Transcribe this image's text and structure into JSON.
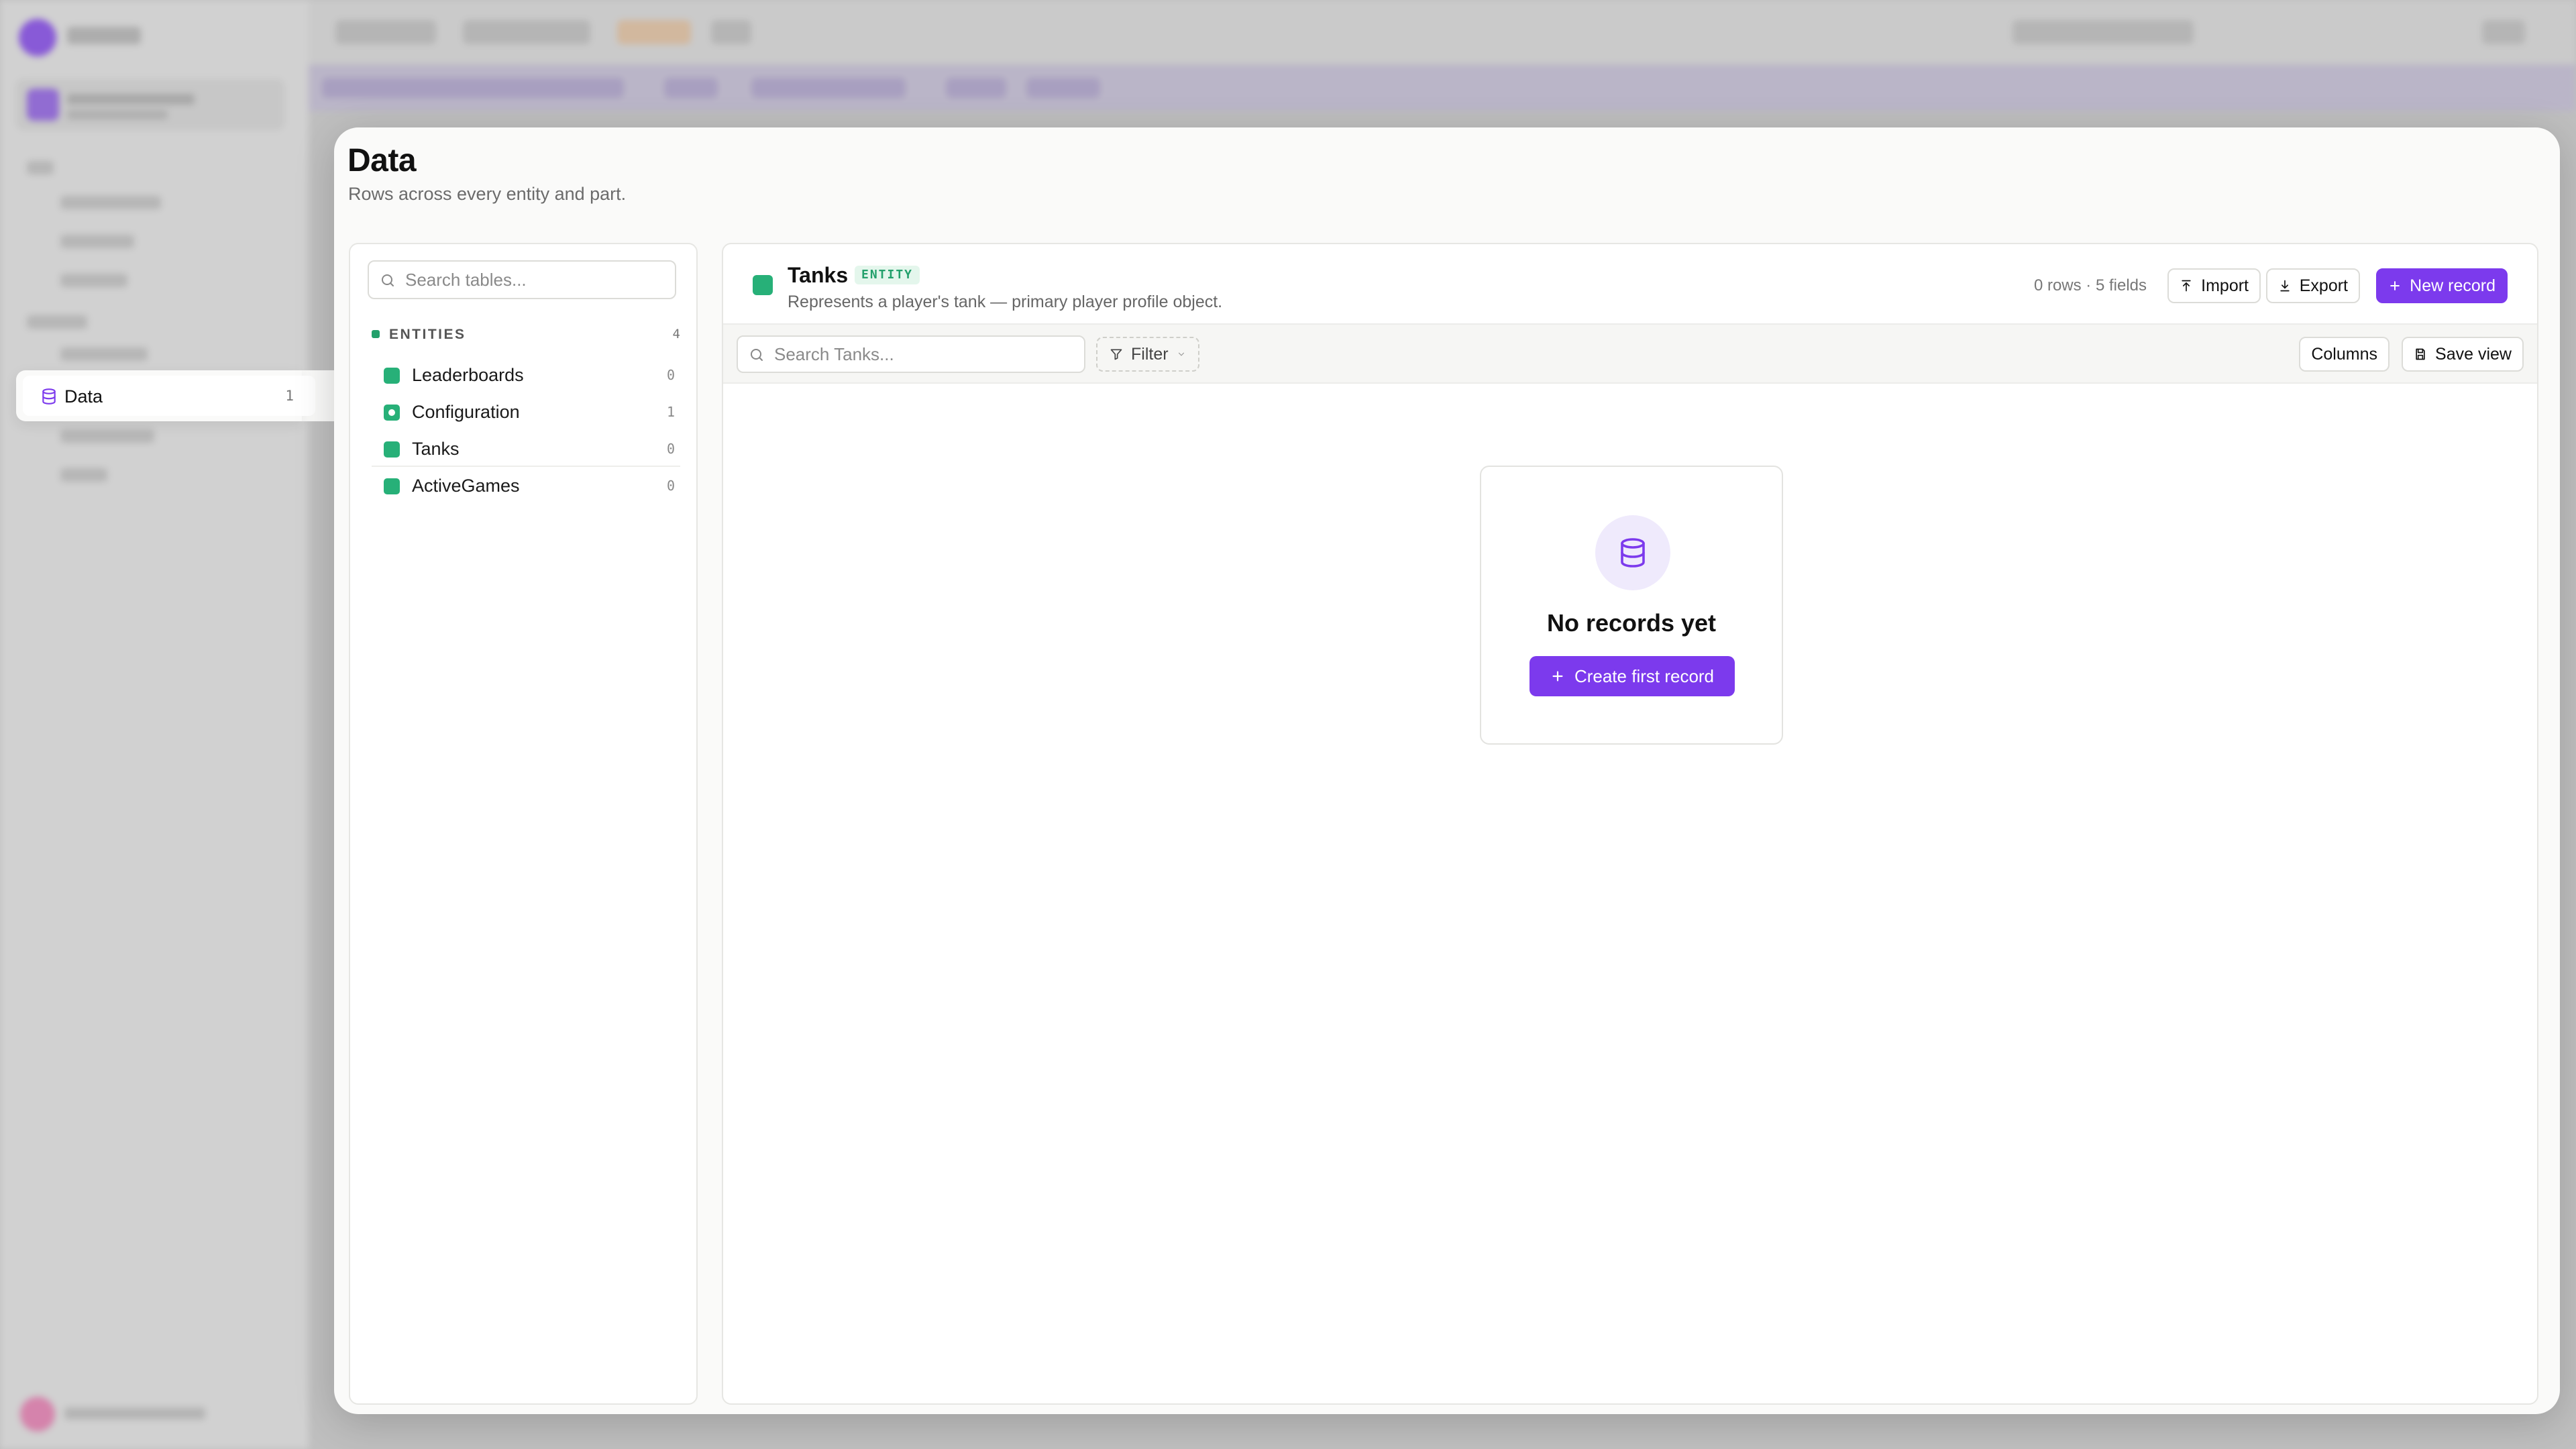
{
  "nav": {
    "active_item": {
      "label": "Data",
      "count": "1",
      "icon": "database-icon"
    }
  },
  "page": {
    "title": "Data",
    "subtitle": "Rows across every entity and part."
  },
  "tables_panel": {
    "search_placeholder": "Search tables...",
    "section_label": "ENTITIES",
    "section_count": "4",
    "items": [
      {
        "name": "Leaderboards",
        "count": "0"
      },
      {
        "name": "Configuration",
        "count": "1"
      },
      {
        "name": "Tanks",
        "count": "0"
      },
      {
        "name": "ActiveGames",
        "count": "0"
      }
    ]
  },
  "table": {
    "name": "Tanks",
    "badge": "ENTITY",
    "description": "Represents a player's tank — primary player profile object.",
    "meta": "0 rows · 5 fields",
    "import_label": "Import",
    "export_label": "Export",
    "new_record_label": "New record",
    "search_placeholder": "Search Tanks...",
    "filter_label": "Filter",
    "columns_label": "Columns",
    "save_view_label": "Save view"
  },
  "empty_state": {
    "title": "No records yet",
    "button_label": "Create first record"
  },
  "colors": {
    "accent": "#7c3aed",
    "entity_green": "#27b078",
    "badge_bg": "#e4f6ec",
    "empty_icon_bg": "#efeafc"
  }
}
